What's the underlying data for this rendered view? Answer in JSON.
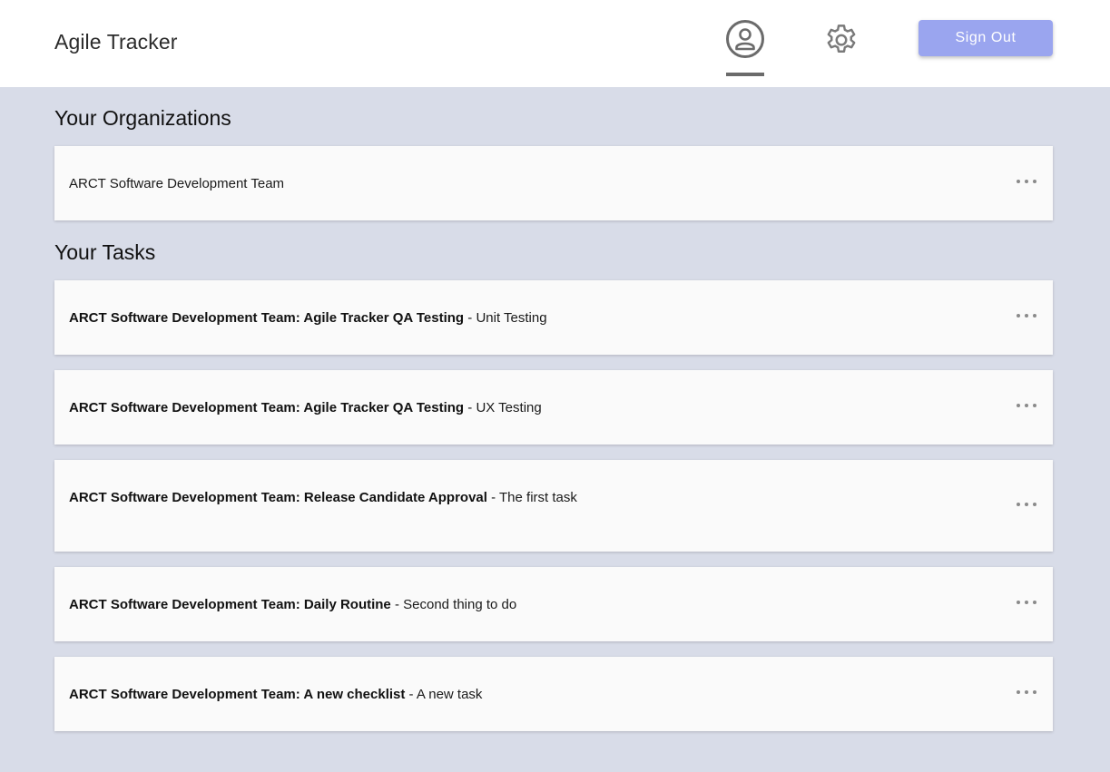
{
  "header": {
    "app_title": "Agile Tracker",
    "profile_icon": "account-circle-icon",
    "settings_icon": "gear-icon",
    "signout_label": "Sign Out",
    "accent_color": "#9aa5ef"
  },
  "organizations": {
    "heading": "Your Organizations",
    "items": [
      {
        "name": "ARCT Software Development Team"
      }
    ]
  },
  "tasks": {
    "heading": "Your Tasks",
    "items": [
      {
        "title": "ARCT Software Development Team: Agile Tracker QA Testing",
        "separator": " - ",
        "detail": "Unit Testing"
      },
      {
        "title": "ARCT Software Development Team: Agile Tracker QA Testing",
        "separator": " - ",
        "detail": "UX Testing"
      },
      {
        "title": "ARCT Software Development Team: Release Candidate Approval",
        "separator": " - ",
        "detail": "The first task"
      },
      {
        "title": "ARCT Software Development Team: Daily Routine",
        "separator": " - ",
        "detail": "Second thing to do"
      },
      {
        "title": "ARCT Software Development Team: A new checklist",
        "separator": " - ",
        "detail": "A new task"
      }
    ]
  },
  "more_icon": "more-horizontal-icon"
}
